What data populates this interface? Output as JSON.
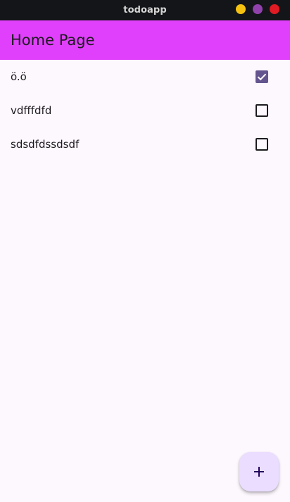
{
  "window": {
    "title": "todoapp",
    "controls": [
      {
        "name": "minimize",
        "color": "#f5c211"
      },
      {
        "name": "maximize",
        "color": "#9141ac"
      },
      {
        "name": "close",
        "color": "#e01b24"
      }
    ]
  },
  "appbar": {
    "title": "Home Page",
    "background": "#e040fb"
  },
  "todos": [
    {
      "label": "ö.ö",
      "checked": true
    },
    {
      "label": "vdfffdfd",
      "checked": false
    },
    {
      "label": "sdsdfdssdsdf",
      "checked": false
    }
  ],
  "fab": {
    "icon": "plus-icon",
    "background": "#eaddff"
  },
  "colors": {
    "accent": "#65558f",
    "surface": "#fdf7fe"
  }
}
